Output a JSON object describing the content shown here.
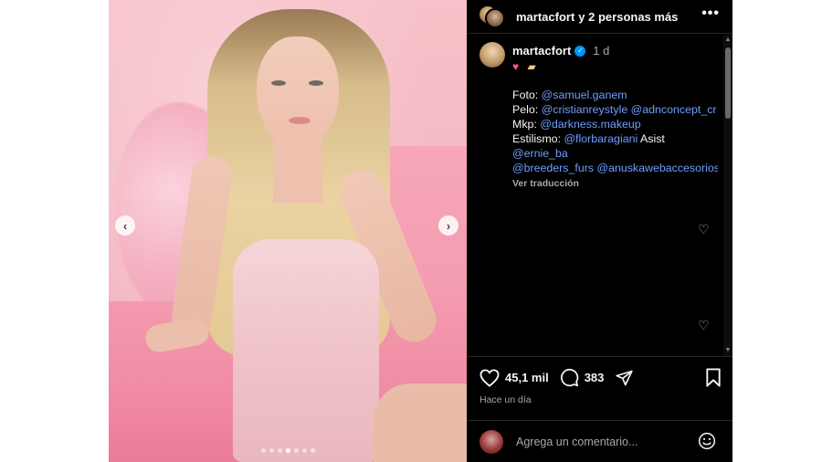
{
  "header": {
    "username": "martacfort",
    "others": "y 2 personas más",
    "more_icon": "ellipsis-icon"
  },
  "caption": {
    "username": "martacfort",
    "verified": true,
    "time": "1 d",
    "emojis": [
      "pink-heart",
      "birthday-cake"
    ],
    "lines": [
      {
        "label": "Foto:",
        "mentions": [
          "@samuel.ganem"
        ],
        "suffix": ""
      },
      {
        "label": "Pelo:",
        "mentions": [
          "@cristianreystyle",
          "@adnconcept_cr"
        ],
        "suffix": ""
      },
      {
        "label": "Mkp:",
        "mentions": [
          "@darkness.makeup"
        ],
        "suffix": ""
      },
      {
        "label": "Estilismo:",
        "mentions": [
          "@florbaragiani"
        ],
        "suffix": "Asist"
      },
      {
        "label": "",
        "mentions": [
          "@ernie_ba"
        ],
        "suffix": ""
      },
      {
        "label": "",
        "mentions": [
          "@breeders_furs",
          "@anuskawebaccesorios"
        ],
        "suffix": ""
      }
    ],
    "translate": "Ver traducción"
  },
  "actions": {
    "likes": "45,1 mil",
    "comments": "383",
    "date": "Hace un día"
  },
  "composer": {
    "placeholder": "Agrega un comentario..."
  },
  "carousel": {
    "total": 7,
    "active": 4
  },
  "colors": {
    "panel_bg": "#000000",
    "mention": "#6d9eff",
    "verified": "#0095f6",
    "photo_tone": "#f3b8c1"
  }
}
